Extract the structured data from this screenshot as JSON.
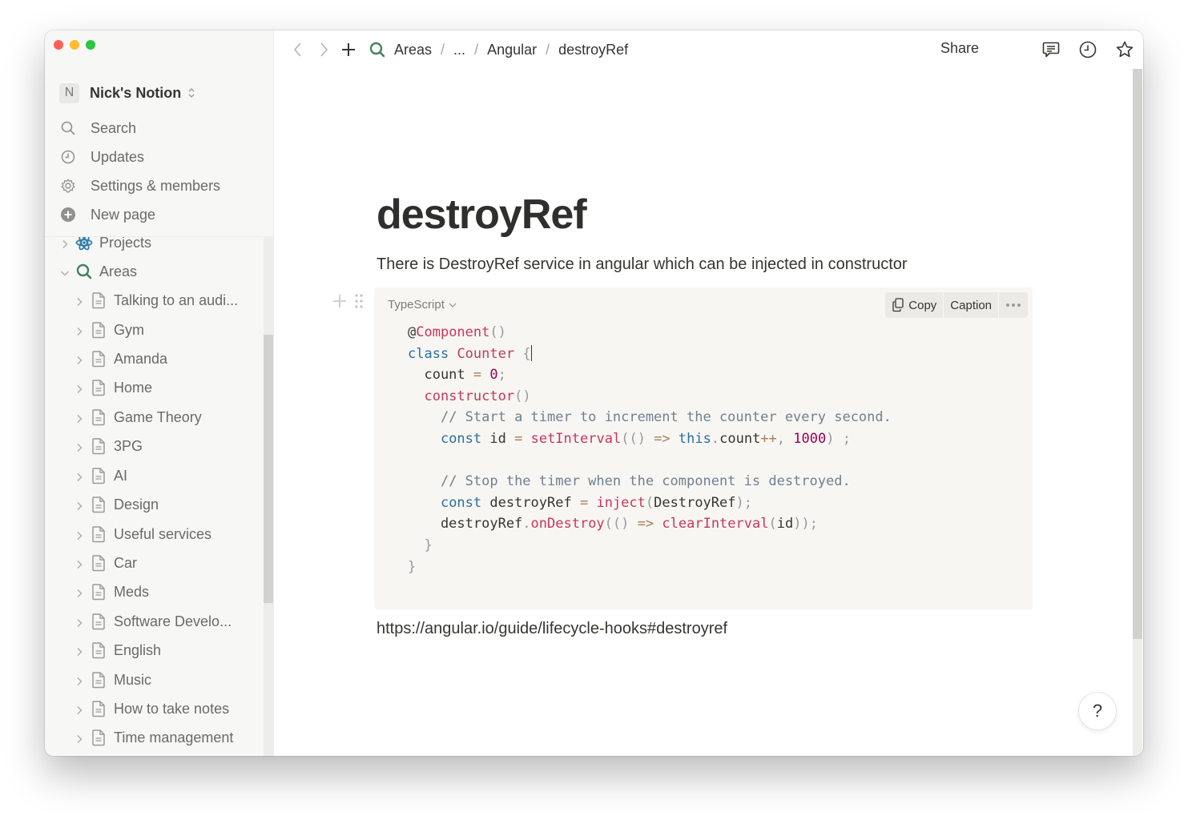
{
  "sidebar": {
    "workspace": {
      "initial": "N",
      "name": "Nick's Notion"
    },
    "nav": [
      {
        "label": "Search",
        "icon": "search-icon"
      },
      {
        "label": "Updates",
        "icon": "clock-icon"
      },
      {
        "label": "Settings & members",
        "icon": "gear-icon"
      },
      {
        "label": "New page",
        "icon": "plus-circle-icon"
      }
    ],
    "tree": [
      {
        "label": "Projects",
        "icon": "atom-icon",
        "expanded": false,
        "level": 0
      },
      {
        "label": "Areas",
        "icon": "search-icon",
        "expanded": true,
        "level": 0
      },
      {
        "label": "Talking to an audi...",
        "icon": "page-icon",
        "level": 1
      },
      {
        "label": "Gym",
        "icon": "page-icon",
        "level": 1
      },
      {
        "label": "Amanda",
        "icon": "page-icon",
        "level": 1
      },
      {
        "label": "Home",
        "icon": "page-icon",
        "level": 1
      },
      {
        "label": "Game Theory",
        "icon": "page-icon",
        "level": 1
      },
      {
        "label": "3PG",
        "icon": "page-icon",
        "level": 1
      },
      {
        "label": "AI",
        "icon": "page-icon",
        "level": 1
      },
      {
        "label": "Design",
        "icon": "page-icon",
        "level": 1
      },
      {
        "label": "Useful services",
        "icon": "page-icon",
        "level": 1
      },
      {
        "label": "Car",
        "icon": "page-icon",
        "level": 1
      },
      {
        "label": "Meds",
        "icon": "page-icon",
        "level": 1
      },
      {
        "label": "Software Develo...",
        "icon": "page-icon",
        "level": 1
      },
      {
        "label": "English",
        "icon": "page-icon",
        "level": 1
      },
      {
        "label": "Music",
        "icon": "page-icon",
        "level": 1
      },
      {
        "label": "How to take notes",
        "icon": "page-icon",
        "level": 1
      },
      {
        "label": "Time management",
        "icon": "page-icon",
        "level": 1
      }
    ]
  },
  "topbar": {
    "breadcrumb": [
      "Areas",
      "...",
      "Angular",
      "destroyRef"
    ],
    "share_label": "Share"
  },
  "page": {
    "title": "destroyRef",
    "description": "There is DestroyRef service in angular which can be injected in constructor",
    "code_block": {
      "language": "TypeScript",
      "copy_label": "Copy",
      "caption_label": "Caption",
      "lines": [
        "@Component()",
        "class Counter {",
        "  count = 0;",
        "  constructor()",
        "    // Start a timer to increment the counter every second.",
        "    const id = setInterval(() => this.count++, 1000) ;",
        "",
        "    // Stop the timer when the component is destroyed.",
        "    const destroyRef = inject(DestroyRef);",
        "    destroyRef.onDestroy(() => clearInterval(id));",
        "  }",
        "}"
      ]
    },
    "link_text": "https://angular.io/guide/lifecycle-hooks#destroyref"
  },
  "help_label": "?",
  "colors": {
    "accent_green": "#448361",
    "projects_blue": "#337ea9",
    "sidebar_bg": "#f7f7f5",
    "code_bg": "#f7f6f3"
  }
}
